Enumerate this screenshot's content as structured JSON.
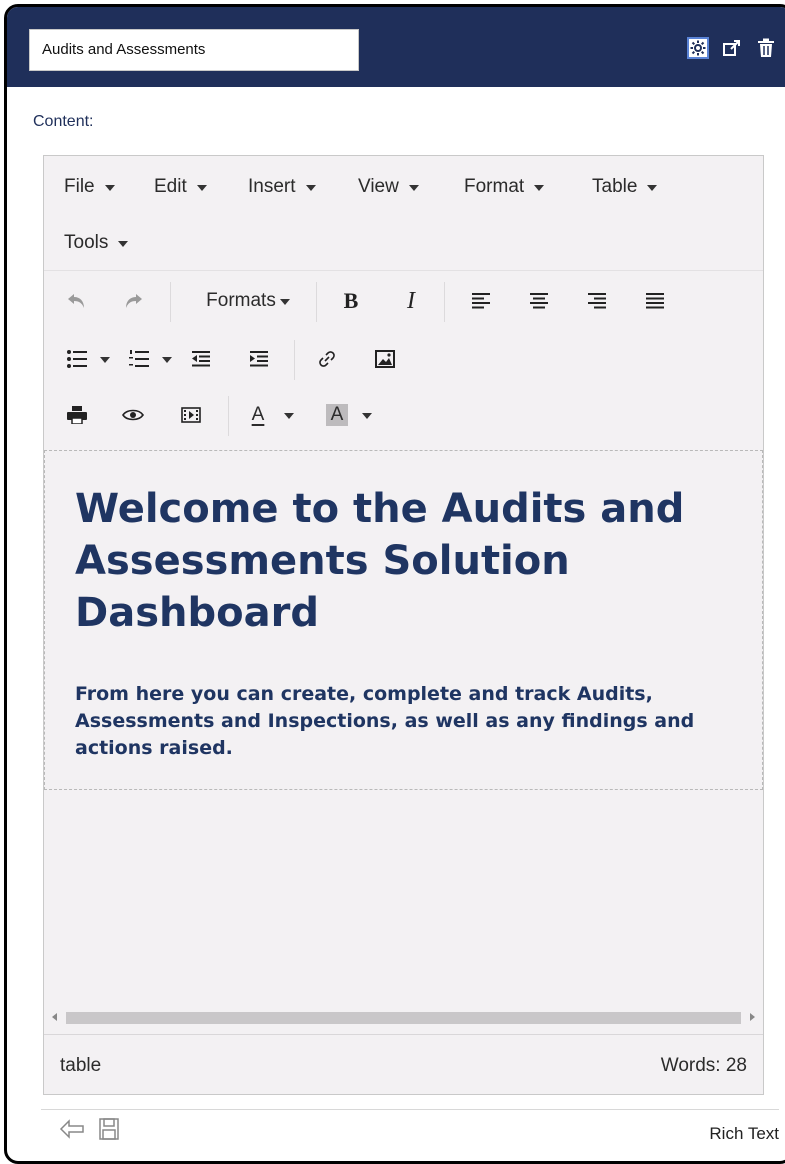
{
  "header": {
    "title_value": "Audits and Assessments",
    "icons": [
      "settings-icon",
      "external-link-icon",
      "trash-icon"
    ]
  },
  "content_label": "Content:",
  "menubar": {
    "items": [
      {
        "label": "File"
      },
      {
        "label": "Edit"
      },
      {
        "label": "Insert"
      },
      {
        "label": "View"
      },
      {
        "label": "Format"
      },
      {
        "label": "Table"
      },
      {
        "label": "Tools"
      }
    ]
  },
  "toolbar": {
    "formats_label": "Formats",
    "bold_label": "B",
    "italic_label": "I",
    "text_color_label": "A",
    "bg_color_label": "A"
  },
  "document": {
    "heading": "Welcome to the Audits and Assessments Solution Dashboard",
    "subtext": "From here you can create, complete and track Audits, Assessments and Inspections, as well as any findings and actions raised."
  },
  "status": {
    "path": "table",
    "word_count": "Words: 28"
  },
  "footer": {
    "label": "Rich Text"
  },
  "colors": {
    "header_bg": "#1f2f5a",
    "heading_text": "#1f3562",
    "editor_bg": "#f3f1f3"
  }
}
